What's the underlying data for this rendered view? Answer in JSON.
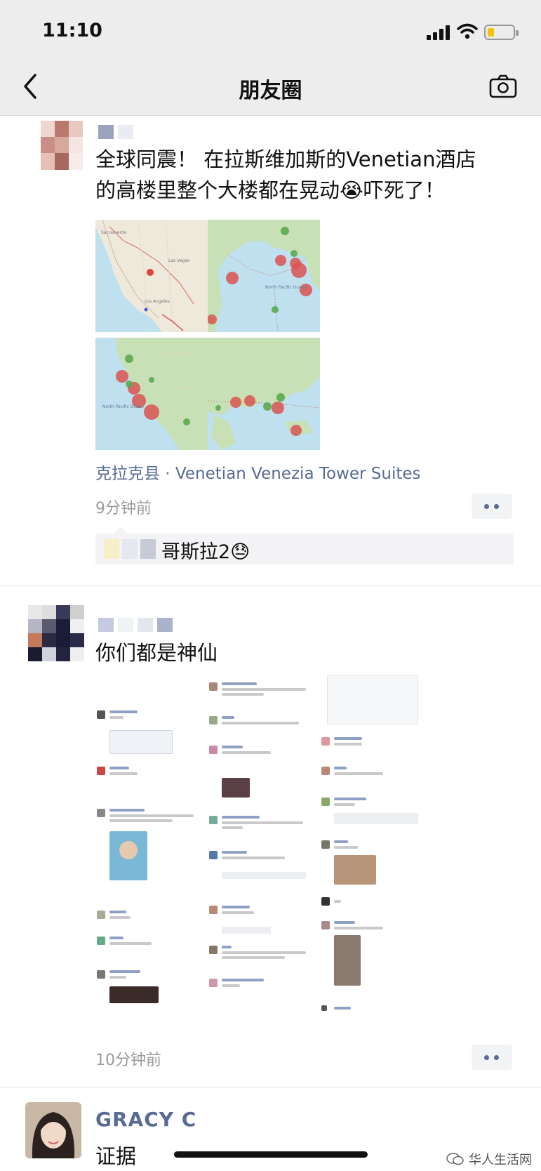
{
  "status_bar": {
    "time": "11:10"
  },
  "nav": {
    "title": "朋友圈"
  },
  "post1": {
    "text_line1": "全球同震！ 在拉斯维加斯的Venetian酒店",
    "text_line2": "的高楼里整个大楼都在晃动😭吓死了！",
    "location": "克拉克县 · Venetian Venezia Tower Suites",
    "time": "9分钟前",
    "comment": "哥斯拉2😓",
    "map_labels": [
      "North Pacific Ocean",
      "North Pacific Ocean"
    ]
  },
  "post2": {
    "text": "你们都是神仙",
    "time": "10分钟前"
  },
  "post3": {
    "name": "GRACY C",
    "text": "证据"
  },
  "watermark": {
    "text": "华人生活网"
  },
  "icons": {
    "back": "chevron-left-icon",
    "camera": "camera-icon",
    "more": "more-dots-icon"
  }
}
